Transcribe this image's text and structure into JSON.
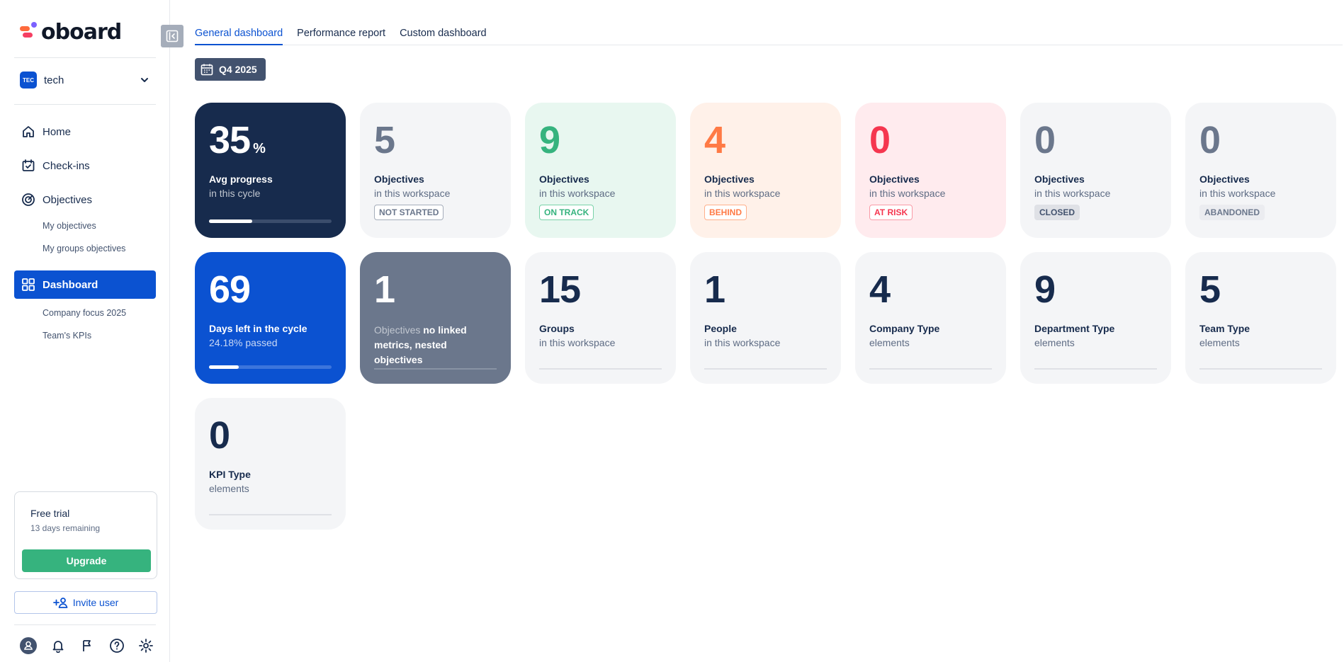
{
  "brand": {
    "name": "oboard"
  },
  "workspace": {
    "badge": "TEC",
    "name": "tech"
  },
  "nav": {
    "home": "Home",
    "checkins": "Check-ins",
    "objectives": "Objectives",
    "my_objectives": "My objectives",
    "my_groups_objectives": "My groups objectives",
    "dashboard": "Dashboard",
    "company_focus": "Company focus 2025",
    "teams_kpis": "Team's KPIs"
  },
  "trial": {
    "title": "Free trial",
    "remaining": "13 days remaining",
    "upgrade_label": "Upgrade"
  },
  "invite_label": "Invite user",
  "footer_icons": [
    "user-icon",
    "bell-icon",
    "flag-icon",
    "help-icon",
    "gear-icon"
  ],
  "tabs": [
    "General dashboard",
    "Performance report",
    "Custom dashboard"
  ],
  "active_tab": "General dashboard",
  "period": "Q4 2025",
  "colors": {
    "primary": "#0b52d1",
    "navy": "#172b4d",
    "success": "#36b37e",
    "behind": "#ff7a45",
    "risk": "#f5364f",
    "neutral": "#6b778c"
  },
  "cards": {
    "avg": {
      "value": "35",
      "unit": "%",
      "title": "Avg progress",
      "sub": "in this cycle",
      "progress": 0.35
    },
    "not_started": {
      "value": "5",
      "title": "Objectives",
      "sub": "in this workspace",
      "badge": "NOT STARTED"
    },
    "on_track": {
      "value": "9",
      "title": "Objectives",
      "sub": "in this workspace",
      "badge": "ON TRACK"
    },
    "behind": {
      "value": "4",
      "title": "Objectives",
      "sub": "in this workspace",
      "badge": "BEHIND"
    },
    "at_risk": {
      "value": "0",
      "title": "Objectives",
      "sub": "in this workspace",
      "badge": "AT RISK"
    },
    "closed": {
      "value": "0",
      "title": "Objectives",
      "sub": "in this workspace",
      "badge": "CLOSED"
    },
    "abandoned": {
      "value": "0",
      "title": "Objectives",
      "sub": "in this workspace",
      "badge": "ABANDONED"
    },
    "days_left": {
      "value": "69",
      "title": "Days left in the cycle",
      "sub": "24.18% passed",
      "progress": 0.2418
    },
    "no_linked": {
      "value": "1",
      "prefix": "Objectives",
      "title": "no linked metrics, nested objectives"
    },
    "groups": {
      "value": "15",
      "title": "Groups",
      "sub": "in this workspace"
    },
    "people": {
      "value": "1",
      "title": "People",
      "sub": "in this workspace"
    },
    "company_type": {
      "value": "4",
      "title": "Company Type",
      "sub": "elements"
    },
    "department_type": {
      "value": "9",
      "title": "Department Type",
      "sub": "elements"
    },
    "team_type": {
      "value": "5",
      "title": "Team Type",
      "sub": "elements"
    },
    "kpi_type": {
      "value": "0",
      "title": "KPI Type",
      "sub": "elements"
    }
  }
}
